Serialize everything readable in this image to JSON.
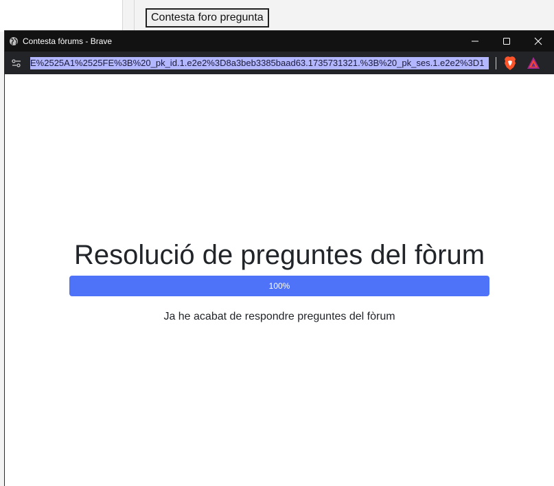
{
  "background_page": {
    "button_label": "Contesta foro pregunta"
  },
  "window": {
    "title": "Contesta fòrums - Brave",
    "controls": {
      "minimize": "minimize-icon",
      "maximize": "maximize-icon",
      "close": "close-icon"
    }
  },
  "address_bar": {
    "url_text": "E%2525A1%2525FE%3B%20_pk_id.1.e2e2%3D8a3beb3385baad63.1735731321.%3B%20_pk_ses.1.e2e2%3D1",
    "site_info_icon": "site-info-icon",
    "shield_icon": "brave-shield-icon",
    "rewards_icon": "brave-rewards-icon"
  },
  "page": {
    "heading": "Resolució de preguntes del fòrum",
    "progress": {
      "value": 100,
      "label": "100%"
    },
    "status": "Ja he acabat de respondre preguntes del fòrum"
  },
  "colors": {
    "progress_fill": "#4e73f8",
    "titlebar": "#121212",
    "addressbar": "#232428",
    "url_selection": "#b3b7ff"
  }
}
